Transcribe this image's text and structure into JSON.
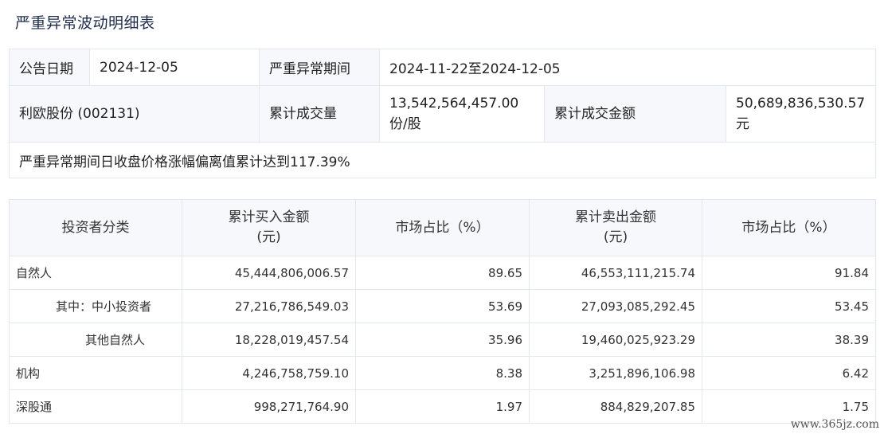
{
  "title": "严重异常波动明细表",
  "info": {
    "announce_date_label": "公告日期",
    "announce_date": "2024-12-05",
    "period_label": "严重异常期间",
    "period": "2024-11-22至2024-12-05",
    "stock": "利欧股份 (002131)",
    "volume_label": "累计成交量",
    "volume": "13,542,564,457.00 份/股",
    "amount_label": "累计成交金额",
    "amount": "50,689,836,530.57 元",
    "note": "严重异常期间日收盘价格涨幅偏离值累计达到117.39%"
  },
  "detail": {
    "headers": [
      "投资者分类",
      "累计买入金额\n(元)",
      "市场占比（%）",
      "累计卖出金额\n(元)",
      "市场占比（%）"
    ],
    "rows": [
      {
        "category": "自然人",
        "buy": "45,444,806,006.57",
        "buy_pct": "89.65",
        "sell": "46,553,111,215.74",
        "sell_pct": "91.84"
      },
      {
        "category": "其中：中小投资者",
        "buy": "27,216,786,549.03",
        "buy_pct": "53.69",
        "sell": "27,093,085,292.45",
        "sell_pct": "53.45"
      },
      {
        "category": "其他自然人",
        "buy": "18,228,019,457.54",
        "buy_pct": "35.96",
        "sell": "19,460,025,923.29",
        "sell_pct": "38.39"
      },
      {
        "category": "机构",
        "buy": "4,246,758,759.10",
        "buy_pct": "8.38",
        "sell": "3,251,896,106.98",
        "sell_pct": "6.42"
      },
      {
        "category": "深股通",
        "buy": "998,271,764.90",
        "buy_pct": "1.97",
        "sell": "884,829,207.85",
        "sell_pct": "1.75"
      }
    ]
  },
  "watermark": "www.365jz.com"
}
